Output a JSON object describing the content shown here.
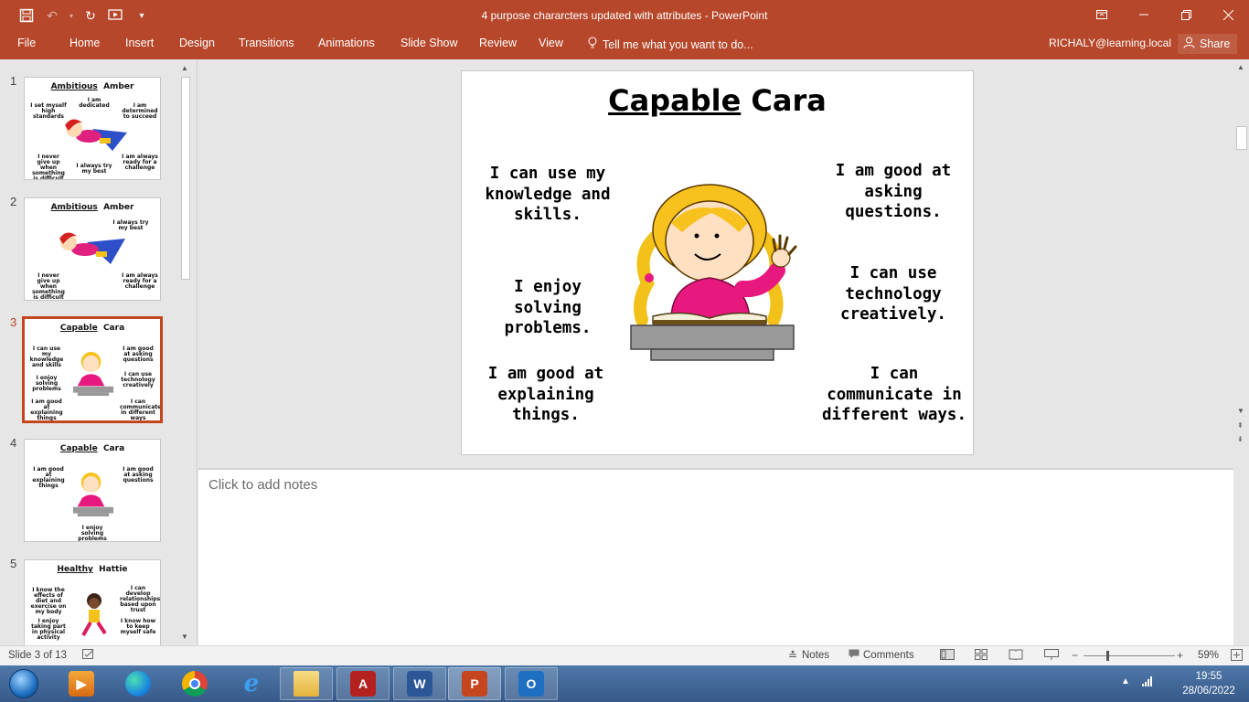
{
  "window": {
    "title": "4 purpose chararcters updated with attributes - PowerPoint",
    "controls": [
      "ribbon-display-options",
      "minimize",
      "restore",
      "close"
    ]
  },
  "qat": {
    "save_icon": "save-icon",
    "undo_icon": "undo-icon",
    "redo_icon": "repeat-icon",
    "slideshow_icon": "start-from-beginning-icon"
  },
  "ribbon": {
    "tabs": [
      "File",
      "Home",
      "Insert",
      "Design",
      "Transitions",
      "Animations",
      "Slide Show",
      "Review",
      "View"
    ],
    "tell_me": "Tell me what you want to do...",
    "account": "RICHALY@learning.local",
    "share": "Share"
  },
  "thumbnails": [
    {
      "num": "1",
      "title_a": "Ambitious",
      "title_b": "Amber"
    },
    {
      "num": "2",
      "title_a": "Ambitious",
      "title_b": "Amber"
    },
    {
      "num": "3",
      "title_a": "Capable",
      "title_b": "Cara"
    },
    {
      "num": "4",
      "title_a": "Capable",
      "title_b": "Cara"
    },
    {
      "num": "5",
      "title_a": "Healthy",
      "title_b": "Hattie"
    }
  ],
  "slide": {
    "title_a": "Capable",
    "title_b": "Cara",
    "left": [
      "I can use my knowledge and skills.",
      "I enjoy solving problems.",
      "I am good at explaining things."
    ],
    "right": [
      "I am good at asking questions.",
      "I can use technology creatively.",
      "I can communicate in different ways."
    ]
  },
  "notes": {
    "placeholder": "Click to add notes"
  },
  "status": {
    "slide_info": "Slide 3 of 13",
    "notes": "Notes",
    "comments": "Comments",
    "zoom": "59%"
  },
  "taskbar": {
    "apps": [
      "media-player",
      "edge",
      "chrome",
      "internet-explorer",
      "file-explorer",
      "acrobat",
      "word",
      "powerpoint",
      "outlook"
    ],
    "time": "19:55",
    "date": "28/06/2022"
  },
  "colors": {
    "accent": "#b7472a",
    "active_thumb_border": "#c5451f",
    "taskbar": "#3f6594"
  }
}
